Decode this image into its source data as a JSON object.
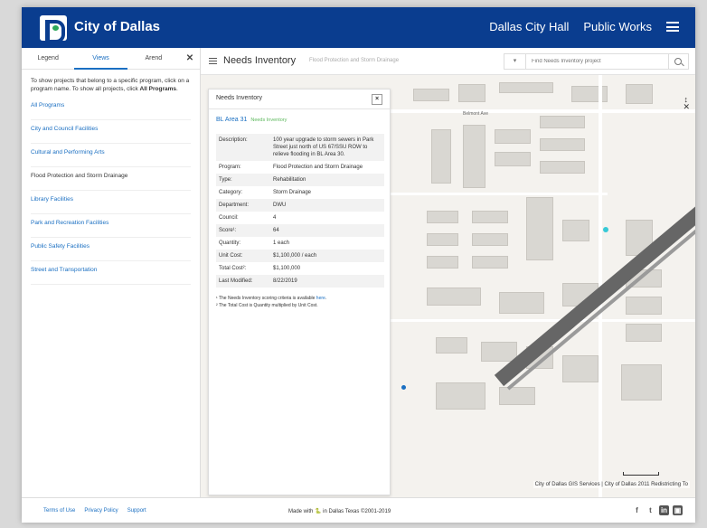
{
  "header": {
    "brand": "City of Dallas",
    "nav": [
      "Dallas City Hall",
      "Public Works"
    ]
  },
  "sidebar": {
    "tabs": [
      "Legend",
      "Views",
      "Arend"
    ],
    "active_tab": "Views",
    "intro_pre": "To show projects that belong to a specific program, click on a program name. To show all projects, click ",
    "intro_bold": "All Programs",
    "intro_post": ".",
    "items": [
      "All Programs",
      "City and Council Facilities",
      "Cultural and Performing Arts",
      "Flood Protection and Storm Drainage",
      "Library Facilities",
      "Park and Recreation Facilities",
      "Public Safety Facilities",
      "Street and Transportation"
    ],
    "current_item": "Flood Protection and Storm Drainage"
  },
  "toolbar": {
    "title": "Needs Inventory",
    "subtitle": "Flood Protection and Storm Drainage",
    "search_dropdown": "▾",
    "search_placeholder": "Find Needs Inventory project"
  },
  "panel": {
    "header": "Needs Inventory",
    "close": "×",
    "name": "BL Area 31",
    "status": "Needs Inventory",
    "rows": [
      {
        "k": "Description:",
        "v": "100 year upgrade to storm sewers in Park Street just north of US 67/SSU ROW to relieve flooding in BL Area 30."
      },
      {
        "k": "Program:",
        "v": "Flood Protection and Storm Drainage"
      },
      {
        "k": "Type:",
        "v": "Rehabilitation"
      },
      {
        "k": "Category:",
        "v": "Storm Drainage"
      },
      {
        "k": "Department:",
        "v": "DWU"
      },
      {
        "k": "Council:",
        "v": "4"
      },
      {
        "k": "Score¹:",
        "v": "64"
      },
      {
        "k": "Quantity:",
        "v": "1 each"
      },
      {
        "k": "Unit Cost:",
        "v": "$1,100,000 / each"
      },
      {
        "k": "Total Cost²:",
        "v": "$1,100,000"
      },
      {
        "k": "Last Modified:",
        "v": "8/22/2019"
      }
    ],
    "footnote1_pre": "¹ The Needs Inventory scoring criteria is available ",
    "footnote1_link": "here",
    "footnote1_post": ".",
    "footnote2": "² The Total Cost is Quantity multiplied by Unit Cost."
  },
  "map": {
    "street_label": "Belmont Ave",
    "attribution": "City of Dallas GIS Services | City of Dallas 2011 Redistricting To",
    "compass": "↕",
    "close": "✕",
    "marker_colors": {
      "cyan": "#37c9d6",
      "blue": "#1a6fc2"
    }
  },
  "footer": {
    "links": [
      "Terms of Use",
      "Privacy Policy",
      "Support"
    ],
    "made_with": "Made with 🐍 in Dallas Texas ©2001-2019",
    "social": [
      "f",
      "t",
      "in",
      "▣"
    ]
  },
  "colors": {
    "header_bg": "#0a3d8f",
    "link": "#1a6fc2",
    "status_green": "#5cb85c"
  }
}
